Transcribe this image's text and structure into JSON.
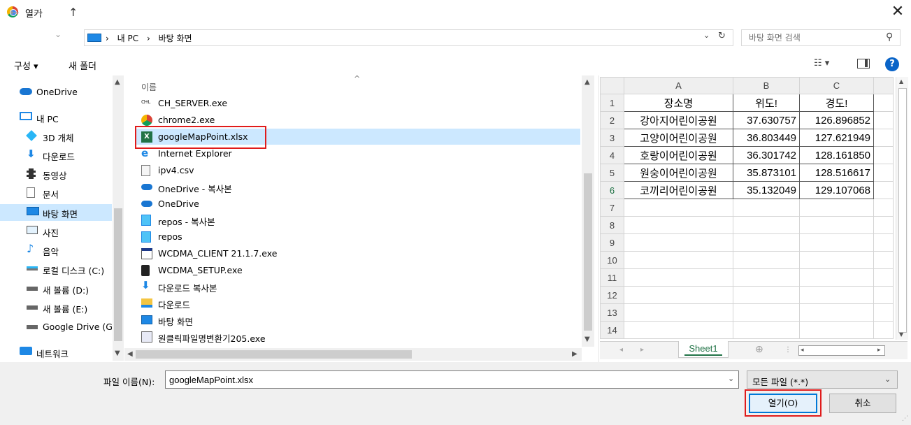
{
  "window": {
    "title": "열기",
    "close_glyph": "✕"
  },
  "nav": {
    "back": "←",
    "forward": "→",
    "recent": "⌄",
    "up": "↑",
    "breadcrumbs": [
      "›",
      "내 PC",
      "›",
      "바탕 화면"
    ],
    "address_dropdown": "⌄",
    "refresh": "↻",
    "search_placeholder": "바탕 화면 검색",
    "search_glyph": "⚲"
  },
  "toolbar": {
    "organize": "구성 ▾",
    "new_folder": "새 폴더",
    "view": "☷ ▾",
    "help": "?"
  },
  "sidebar": {
    "items": [
      {
        "label": "OneDrive",
        "icon": "cloud-icon"
      },
      {
        "label": "내 PC",
        "icon": "computer-icon"
      },
      {
        "label": "3D 개체",
        "icon": "cube-icon"
      },
      {
        "label": "다운로드",
        "icon": "download-icon"
      },
      {
        "label": "동영상",
        "icon": "film-icon"
      },
      {
        "label": "문서",
        "icon": "document-icon"
      },
      {
        "label": "바탕 화면",
        "icon": "desktop-icon"
      },
      {
        "label": "사진",
        "icon": "picture-icon"
      },
      {
        "label": "음악",
        "icon": "music-icon"
      },
      {
        "label": "로컬 디스크 (C:)",
        "icon": "drive-icon"
      },
      {
        "label": "새 볼륨 (D:)",
        "icon": "drive-icon"
      },
      {
        "label": "새 볼륨 (E:)",
        "icon": "drive-icon"
      },
      {
        "label": "Google Drive (G",
        "icon": "drive-icon"
      },
      {
        "label": "네트워크",
        "icon": "network-icon"
      }
    ],
    "selected_index": 6
  },
  "filelist": {
    "column_name": "이름",
    "sort_glyph": "^",
    "files": [
      {
        "name": "CH_SERVER.exe",
        "icon": "exe-icon"
      },
      {
        "name": "chrome2.exe",
        "icon": "chrome-icon"
      },
      {
        "name": "googleMapPoint.xlsx",
        "icon": "excel-icon"
      },
      {
        "name": "Internet Explorer",
        "icon": "ie-icon"
      },
      {
        "name": "ipv4.csv",
        "icon": "csv-icon"
      },
      {
        "name": "OneDrive - 복사본",
        "icon": "onedrive-icon"
      },
      {
        "name": "OneDrive",
        "icon": "onedrive-icon"
      },
      {
        "name": "repos - 복사본",
        "icon": "shortcut-folder-icon"
      },
      {
        "name": "repos",
        "icon": "shortcut-folder-icon"
      },
      {
        "name": "WCDMA_CLIENT 21.1.7.exe",
        "icon": "window-exe-icon"
      },
      {
        "name": "WCDMA_SETUP.exe",
        "icon": "installer-icon"
      },
      {
        "name": "다운로드 복사본",
        "icon": "download-shortcut-icon"
      },
      {
        "name": "다운로드",
        "icon": "folder-icon"
      },
      {
        "name": "바탕 화면",
        "icon": "desktop-folder-icon"
      },
      {
        "name": "원클릭파일명변환기205.exe",
        "icon": "app-icon"
      }
    ],
    "selected_index": 2
  },
  "preview": {
    "columns": [
      "A",
      "B",
      "C"
    ],
    "rows": [
      [
        "장소명",
        "위도!",
        "경도!"
      ],
      [
        "강아지어린이공원",
        "37.630757",
        "126.896852"
      ],
      [
        "고양이어린이공원",
        "36.803449",
        "127.621949"
      ],
      [
        "호랑이어린이공원",
        "36.301742",
        "128.161850"
      ],
      [
        "원숭이어린이공원",
        "35.873101",
        "128.516617"
      ],
      [
        "코끼리어린이공원",
        "35.132049",
        "129.107068"
      ]
    ],
    "row_numbers": [
      "1",
      "2",
      "3",
      "4",
      "5",
      "6",
      "7",
      "8",
      "9",
      "10",
      "11",
      "12",
      "13",
      "14"
    ],
    "sheet_tab": "Sheet1",
    "add_sheet": "⊕"
  },
  "bottom": {
    "filename_label": "파일 이름(N):",
    "filename_value": "googleMapPoint.xlsx",
    "filetype": "모든 파일 (*.*)",
    "open": "열기(O)",
    "cancel": "취소"
  },
  "colors": {
    "selection": "#cce8ff",
    "highlight": "#e01b1b",
    "accent": "#0078d7",
    "excel_green": "#217346"
  }
}
